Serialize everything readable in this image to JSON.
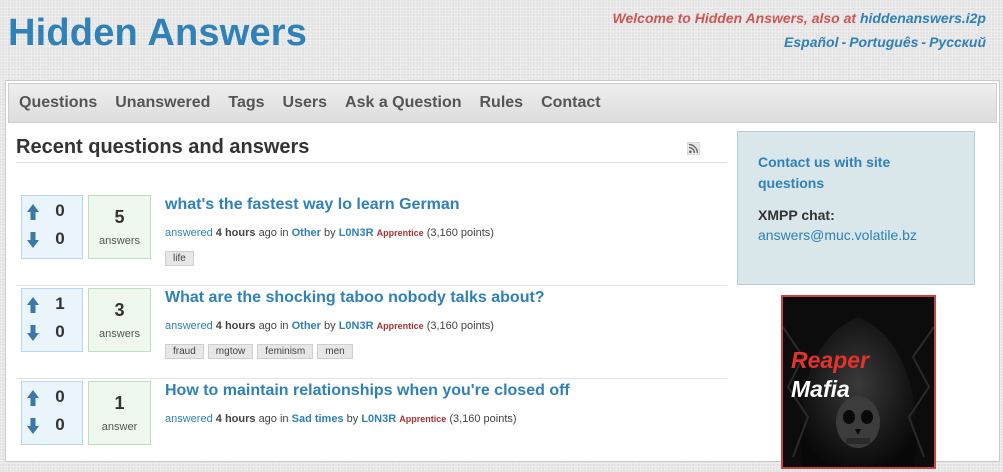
{
  "header": {
    "site_title": "Hidden Answers",
    "welcome": "Welcome to Hidden Answers, also at",
    "alt_domain": "hiddenanswers.i2p",
    "languages": [
      "Español",
      "Português",
      "Pусский"
    ],
    "lang_separator": "-"
  },
  "nav": {
    "items": [
      "Questions",
      "Unanswered",
      "Tags",
      "Users",
      "Ask a Question",
      "Rules",
      "Contact"
    ]
  },
  "main": {
    "heading": "Recent questions and answers",
    "questions": [
      {
        "upvotes": "0",
        "downvotes": "0",
        "answers": "5",
        "answers_label": "answers",
        "title": "what's the fastest way lo learn German",
        "action": "answered",
        "time": "4 hours",
        "ago": "ago in",
        "category": "Other",
        "by": "by",
        "user": "L0N3R",
        "rank": "Apprentice",
        "points": "(3,160 points)",
        "tags": [
          "life"
        ]
      },
      {
        "upvotes": "1",
        "downvotes": "0",
        "answers": "3",
        "answers_label": "answers",
        "title": "What are the shocking taboo nobody talks about?",
        "action": "answered",
        "time": "4 hours",
        "ago": "ago in",
        "category": "Other",
        "by": "by",
        "user": "L0N3R",
        "rank": "Apprentice",
        "points": "(3,160 points)",
        "tags": [
          "fraud",
          "mgtow",
          "feminism",
          "men"
        ]
      },
      {
        "upvotes": "0",
        "downvotes": "0",
        "answers": "1",
        "answers_label": "answer",
        "title": "How to maintain relationships when you're closed off",
        "action": "answered",
        "time": "4 hours",
        "ago": "ago in",
        "category": "Sad times",
        "by": "by",
        "user": "L0N3R",
        "rank": "Apprentice",
        "points": "(3,160 points)",
        "tags": []
      }
    ]
  },
  "sidebar": {
    "contact_link": "Contact us with site questions",
    "xmpp_label": "XMPP chat:",
    "xmpp_value": "answers@muc.volatile.bz",
    "ad": {
      "line1": "Reaper",
      "line2": "Mafia"
    }
  },
  "colors": {
    "brand_blue": "#2f81b7",
    "welcome_red": "#d05555",
    "vote_arrow": "#3b77a8",
    "ad_red": "#e3332a"
  },
  "icons": [
    "rss-icon",
    "upvote-arrow-icon",
    "downvote-arrow-icon",
    "skull-icon"
  ]
}
